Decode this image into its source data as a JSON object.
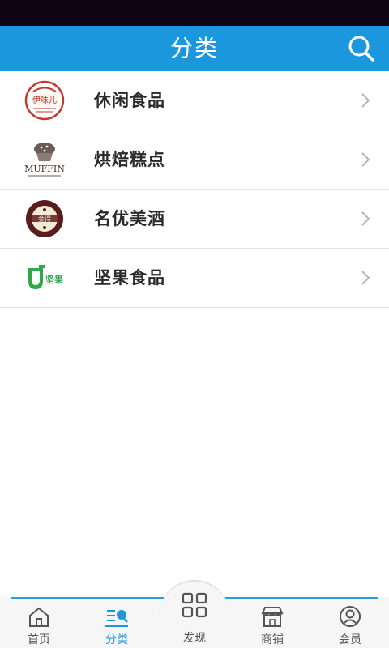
{
  "header": {
    "title": "分类",
    "search_icon": "search-icon"
  },
  "categories": [
    {
      "label": "休闲食品",
      "logo_text": "伊味儿",
      "icon": "snack-brand-logo"
    },
    {
      "label": "烘焙糕点",
      "logo_text": "MUFFIN",
      "icon": "muffin-brand-logo"
    },
    {
      "label": "名优美酒",
      "logo_text": "金得",
      "icon": "wine-brand-logo"
    },
    {
      "label": "坚果食品",
      "logo_text": "坚果",
      "icon": "nut-brand-logo"
    }
  ],
  "tabbar": {
    "tabs": [
      {
        "label": "首页",
        "icon": "home-icon",
        "active": false
      },
      {
        "label": "分类",
        "icon": "category-icon",
        "active": true
      },
      {
        "label": "发现",
        "icon": "grid-icon",
        "active": false
      },
      {
        "label": "商铺",
        "icon": "shop-icon",
        "active": false
      },
      {
        "label": "会员",
        "icon": "user-icon",
        "active": false
      }
    ]
  },
  "colors": {
    "status_bar": "#0f0414",
    "header": "#1b98dd",
    "accent": "#1b98dd",
    "text": "#2a2a2a",
    "divider": "#e3e3e3"
  }
}
